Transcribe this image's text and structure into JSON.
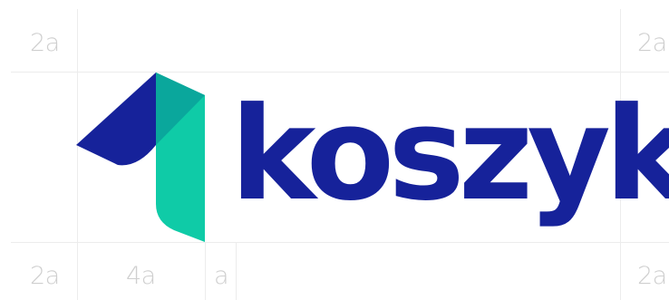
{
  "logo": {
    "wordmark": "koszyk",
    "colors": {
      "navy": "#16229a",
      "teal": "#0fcba7",
      "teal_dark": "#0aa79c",
      "guide": "#ececec",
      "guide_text": "#cfcfcf"
    }
  },
  "guides": {
    "top_left": "2a",
    "top_right": "2a",
    "bottom_left": "2a",
    "bottom_mid": "4a",
    "bottom_small": "a",
    "bottom_right": "2a"
  }
}
